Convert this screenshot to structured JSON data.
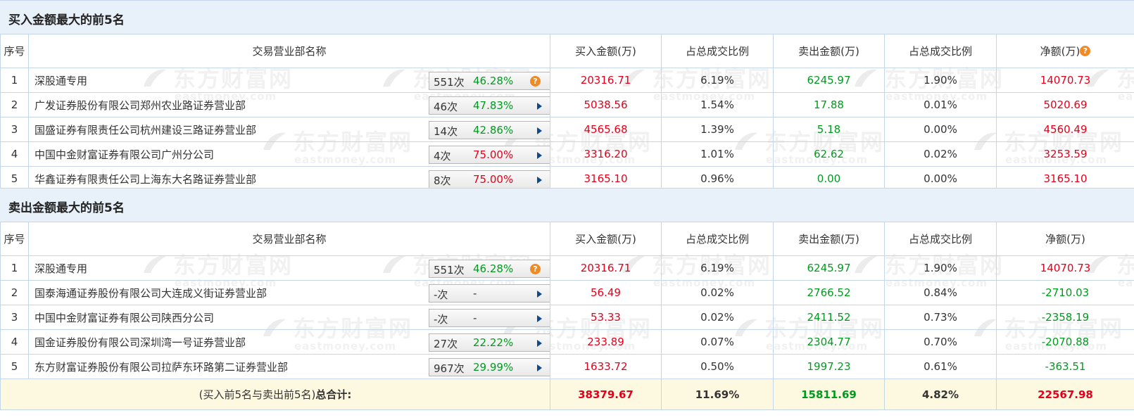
{
  "watermark": {
    "cn": "东方财富网",
    "en": "eastmoney.com"
  },
  "buy_section": {
    "title": "买入金额最大的前5名",
    "headers": [
      "序号",
      "交易营业部名称",
      "买入金额(万)",
      "占总成交比例",
      "卖出金额(万)",
      "占总成交比例",
      "净额(万)"
    ],
    "rows": [
      {
        "rank": "1",
        "name": "深股通专用",
        "count": "551次",
        "rate": "46.28%",
        "rate_color": "green",
        "icon": "question-icon",
        "buy": "20316.71",
        "buy_pct": "6.19%",
        "sell": "6245.97",
        "sell_pct": "1.90%",
        "net": "14070.73"
      },
      {
        "rank": "2",
        "name": "广发证券股份有限公司郑州农业路证券营业部",
        "count": "46次",
        "rate": "47.83%",
        "rate_color": "green",
        "icon": "arrow-right-icon",
        "buy": "5038.56",
        "buy_pct": "1.54%",
        "sell": "17.88",
        "sell_pct": "0.01%",
        "net": "5020.69"
      },
      {
        "rank": "3",
        "name": "国盛证券有限责任公司杭州建设三路证券营业部",
        "count": "14次",
        "rate": "42.86%",
        "rate_color": "green",
        "icon": "arrow-right-icon",
        "buy": "4565.68",
        "buy_pct": "1.39%",
        "sell": "5.18",
        "sell_pct": "0.00%",
        "net": "4560.49"
      },
      {
        "rank": "4",
        "name": "中国中金财富证券有限公司广州分公司",
        "count": "4次",
        "rate": "75.00%",
        "rate_color": "red",
        "icon": "arrow-right-icon",
        "buy": "3316.20",
        "buy_pct": "1.01%",
        "sell": "62.62",
        "sell_pct": "0.02%",
        "net": "3253.59"
      },
      {
        "rank": "5",
        "name": "华鑫证券有限责任公司上海东大名路证券营业部",
        "count": "8次",
        "rate": "75.00%",
        "rate_color": "red",
        "icon": "arrow-right-icon",
        "buy": "3165.10",
        "buy_pct": "0.96%",
        "sell": "0.00",
        "sell_pct": "0.00%",
        "net": "3165.10"
      }
    ]
  },
  "sell_section": {
    "title": "卖出金额最大的前5名",
    "headers": [
      "序号",
      "交易营业部名称",
      "买入金额(万)",
      "占总成交比例",
      "卖出金额(万)",
      "占总成交比例",
      "净额(万)"
    ],
    "rows": [
      {
        "rank": "1",
        "name": "深股通专用",
        "count": "551次",
        "rate": "46.28%",
        "rate_color": "green",
        "icon": "question-icon",
        "buy": "20316.71",
        "buy_pct": "6.19%",
        "sell": "6245.97",
        "sell_pct": "1.90%",
        "net": "14070.73"
      },
      {
        "rank": "2",
        "name": "国泰海通证券股份有限公司大连成义街证券营业部",
        "count": "-次",
        "rate": "-",
        "rate_color": "dark",
        "icon": "arrow-right-icon",
        "buy": "56.49",
        "buy_pct": "0.02%",
        "sell": "2766.52",
        "sell_pct": "0.84%",
        "net": "-2710.03"
      },
      {
        "rank": "3",
        "name": "中国中金财富证券有限公司陕西分公司",
        "count": "-次",
        "rate": "-",
        "rate_color": "dark",
        "icon": "arrow-right-icon",
        "buy": "53.33",
        "buy_pct": "0.02%",
        "sell": "2411.52",
        "sell_pct": "0.73%",
        "net": "-2358.19"
      },
      {
        "rank": "4",
        "name": "国金证券股份有限公司深圳湾一号证券营业部",
        "count": "27次",
        "rate": "22.22%",
        "rate_color": "green",
        "icon": "arrow-right-icon",
        "buy": "233.89",
        "buy_pct": "0.07%",
        "sell": "2304.77",
        "sell_pct": "0.70%",
        "net": "-2070.88"
      },
      {
        "rank": "5",
        "name": "东方财富证券股份有限公司拉萨东环路第二证券营业部",
        "count": "967次",
        "rate": "29.99%",
        "rate_color": "green",
        "icon": "arrow-right-icon",
        "buy": "1633.72",
        "buy_pct": "0.50%",
        "sell": "1997.23",
        "sell_pct": "0.61%",
        "net": "-363.51"
      }
    ]
  },
  "total": {
    "label_prefix": "(买入前5名与卖出前5名)",
    "label_bold": "总合计:",
    "buy": "38379.67",
    "buy_pct": "11.69%",
    "sell": "15811.69",
    "sell_pct": "4.82%",
    "net": "22567.98"
  },
  "colors": {
    "red": "#e4001b",
    "green": "#009b1e",
    "header_bg": "#e8f1fa",
    "total_bg": "#fdf9e1",
    "border": "#c5d6e8"
  }
}
